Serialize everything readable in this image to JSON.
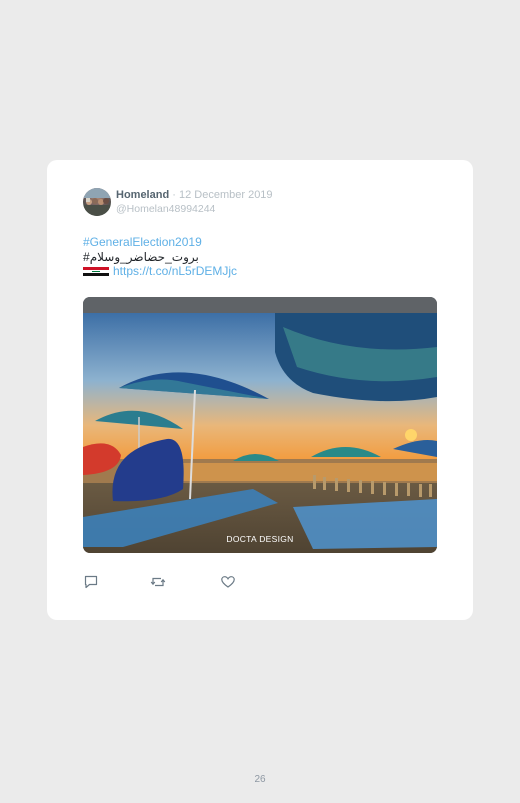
{
  "tweet": {
    "author_name": "Homeland",
    "separator": "·",
    "date": "12 December 2019",
    "handle": "@Homelan48994244",
    "hashtag_line_1": "#GeneralElection2019",
    "hashtag_line_2": "#بروت_حضاضر_وسلام",
    "link": "https://t.co/nL5rDEMJjc",
    "flag_emoji": "iraq-flag-icon",
    "image_watermark": "DOCTA DESIGN",
    "image_description_icon": "beach-umbrellas-photo"
  },
  "actions": {
    "reply_icon": "comment-icon",
    "retweet_icon": "retweet-icon",
    "like_icon": "heart-icon"
  },
  "page": {
    "number": "26"
  },
  "colors": {
    "background": "#ebebeb",
    "card": "#ffffff",
    "link": "#5fb0e6",
    "name": "#566570",
    "muted": "#b8c0c6"
  }
}
